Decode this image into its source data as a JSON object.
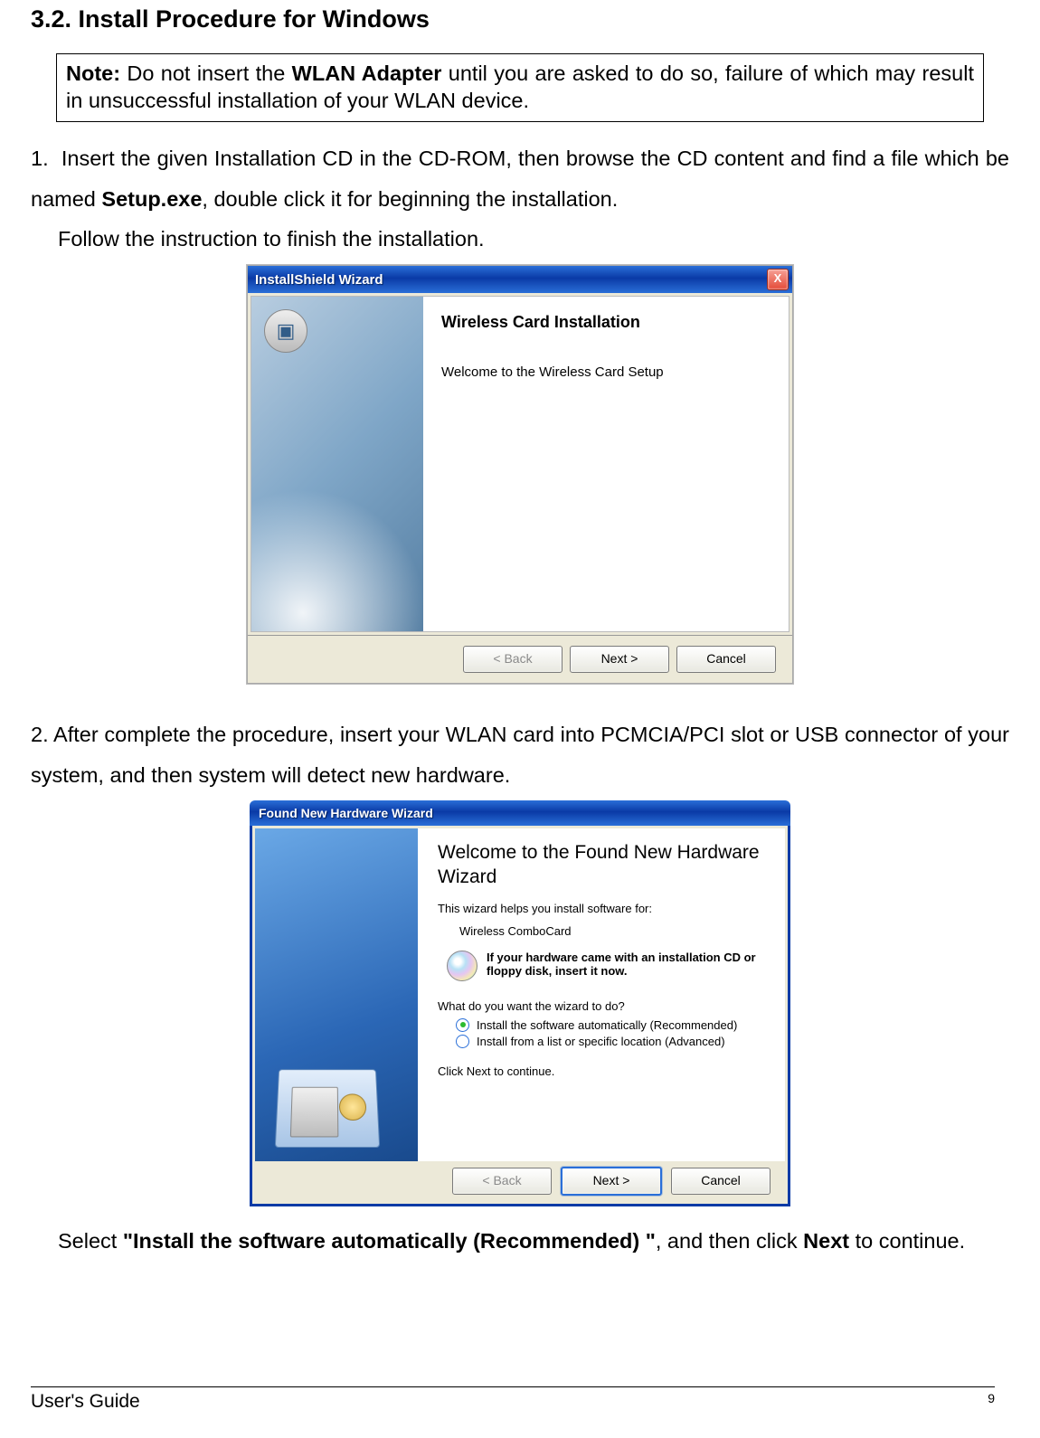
{
  "section_title": "3.2. Install Procedure for Windows",
  "note": {
    "label": "Note:",
    "text_before": " Do not insert the ",
    "bold_term": "WLAN Adapter",
    "text_after": " until you are asked to do so, failure of which may result in unsuccessful installation of your WLAN device."
  },
  "step1": {
    "num": "1.",
    "line1a": "Insert the given Installation CD in the CD-ROM, then browse the CD content and find a file which be named ",
    "bold": "Setup.exe",
    "line1b": ", double click it for beginning the installation.",
    "line2": "Follow the instruction to finish the installation."
  },
  "wizard1": {
    "title": "InstallShield Wizard",
    "close": "X",
    "heading": "Wireless Card Installation",
    "welcome": "Welcome to the Wireless Card Setup",
    "back": "< Back",
    "next": "Next >",
    "cancel": "Cancel"
  },
  "step2": {
    "num": "2.",
    "text": "After complete the procedure, insert your WLAN card into PCMCIA/PCI slot or USB connector of your system, and then system will detect new hardware."
  },
  "wizard2": {
    "title": "Found New Hardware Wizard",
    "heading": "Welcome to the Found New Hardware Wizard",
    "help_text": "This wizard helps you install software for:",
    "device": "Wireless ComboCard",
    "cd_text": "If your hardware came with an installation CD or floppy disk, insert it now.",
    "question": "What do you want the wizard to do?",
    "opt1": "Install the software automatically (Recommended)",
    "opt2": "Install from a list or specific location (Advanced)",
    "click_next": "Click Next to continue.",
    "back": "< Back",
    "next": "Next >",
    "cancel": "Cancel"
  },
  "step2_after": {
    "select": "Select ",
    "bold1": "\"Install the software automatically (Recommended) \"",
    "mid": ", and then click ",
    "bold2": "Next",
    "end": " to continue."
  },
  "footer": {
    "left": "User's Guide",
    "page": "9"
  }
}
